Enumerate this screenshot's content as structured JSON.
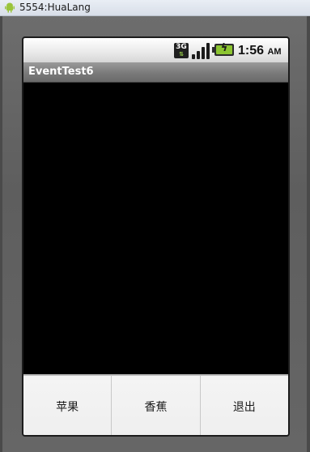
{
  "window": {
    "title": "5554:HuaLang",
    "icon": "android-icon"
  },
  "statusbar": {
    "network_type": "3G",
    "signal_icon": "signal-bars-icon",
    "battery_icon": "battery-charging-icon",
    "time": "1:56",
    "ampm": "AM"
  },
  "app": {
    "title": "EventTest6"
  },
  "menu": {
    "items": [
      {
        "label": "苹果"
      },
      {
        "label": "香蕉"
      },
      {
        "label": "退出"
      }
    ]
  },
  "colors": {
    "screen_bg": "#000000",
    "battery_fill": "#8cc531",
    "menu_bg": "#efefef",
    "frame": "#666666"
  }
}
